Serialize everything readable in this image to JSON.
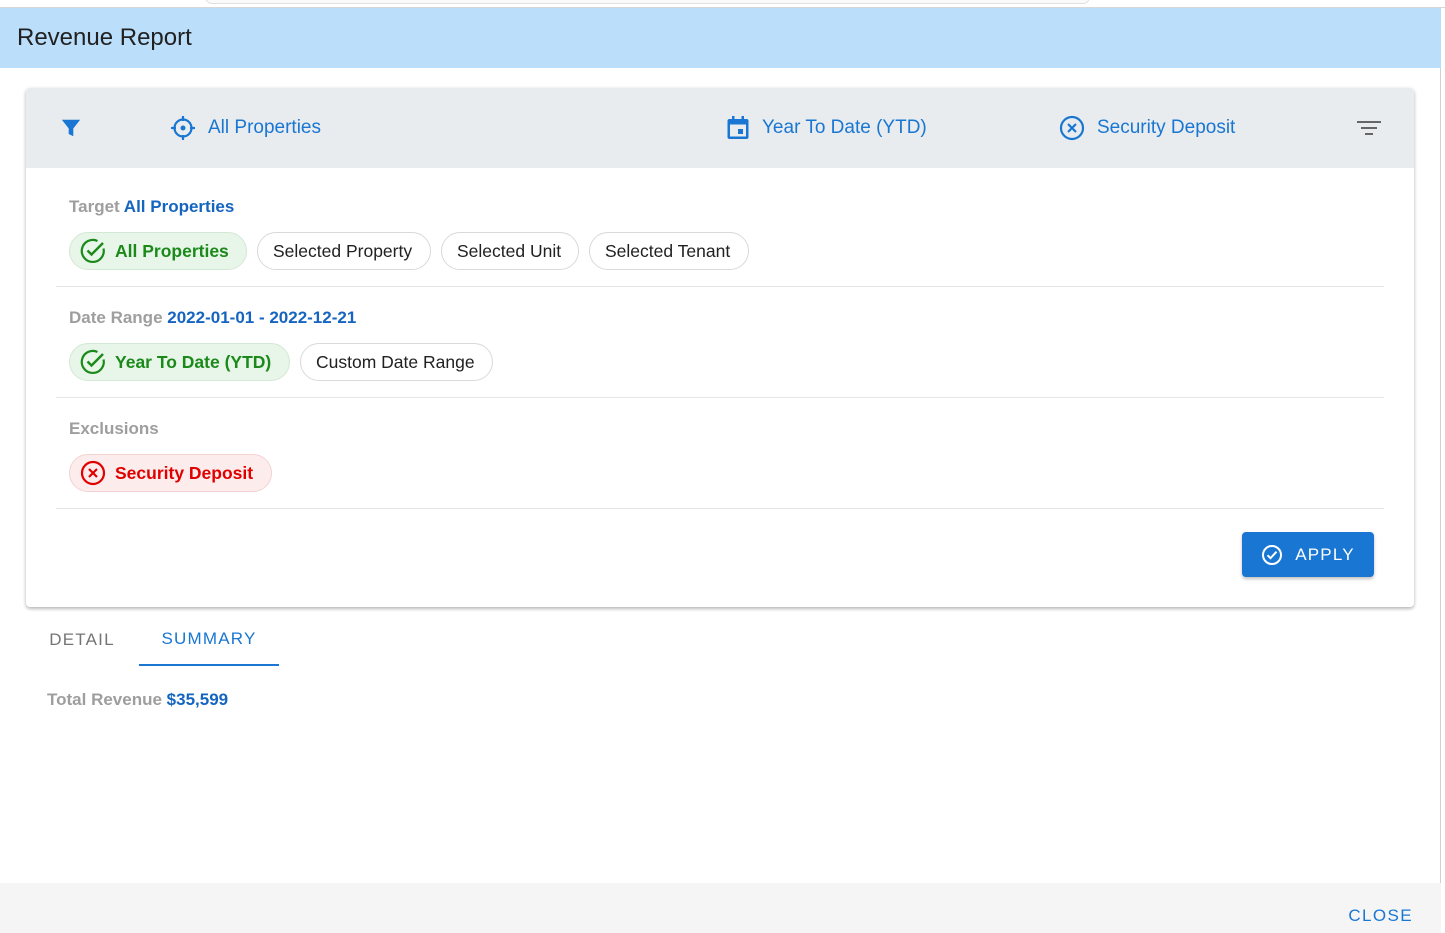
{
  "dialog": {
    "title": "Revenue Report"
  },
  "filter_bar": {
    "target_label": "All Properties",
    "date_label": "Year To Date (YTD)",
    "exclusion_label": "Security Deposit"
  },
  "target_section": {
    "title": "Target",
    "value": "All Properties",
    "chips": [
      {
        "label": "All Properties",
        "selected": true
      },
      {
        "label": "Selected Property",
        "selected": false
      },
      {
        "label": "Selected Unit",
        "selected": false
      },
      {
        "label": "Selected Tenant",
        "selected": false
      }
    ]
  },
  "date_section": {
    "title": "Date Range",
    "value": "2022-01-01 - 2022-12-21",
    "chips": [
      {
        "label": "Year To Date (YTD)",
        "selected": true
      },
      {
        "label": "Custom Date Range",
        "selected": false
      }
    ]
  },
  "exclusions_section": {
    "title": "Exclusions",
    "chips": [
      {
        "label": "Security Deposit",
        "excluded": true
      }
    ]
  },
  "apply_button": {
    "label": "APPLY"
  },
  "tabs": [
    {
      "label": "DETAIL",
      "active": false
    },
    {
      "label": "SUMMARY",
      "active": true
    }
  ],
  "summary": {
    "total_label": "Total Revenue",
    "total_value": "$35,599"
  },
  "footer": {
    "close_label": "CLOSE"
  },
  "colors": {
    "header_bg": "#bbdefb",
    "primary": "#1976d2",
    "success": "#1b8a1b",
    "error": "#e00000"
  }
}
